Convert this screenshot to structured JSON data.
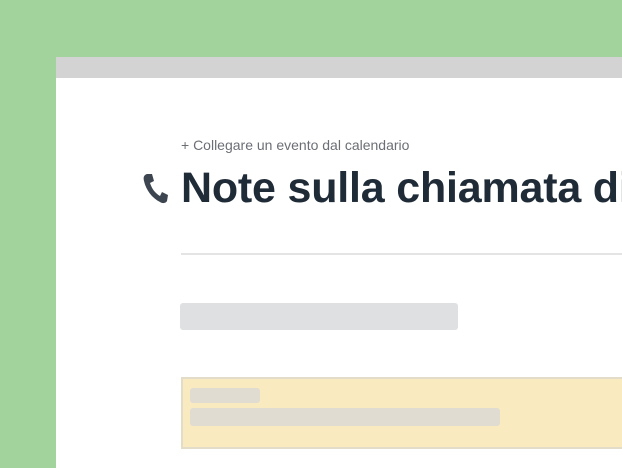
{
  "page": {
    "link_calendar": "+ Collegare un evento dal calendario",
    "title": "Note sulla chiamata di",
    "title_icon": "phone-icon"
  },
  "colors": {
    "background": "#a3d39c",
    "title": "#1f2b37",
    "note_box": "#faeac0"
  }
}
